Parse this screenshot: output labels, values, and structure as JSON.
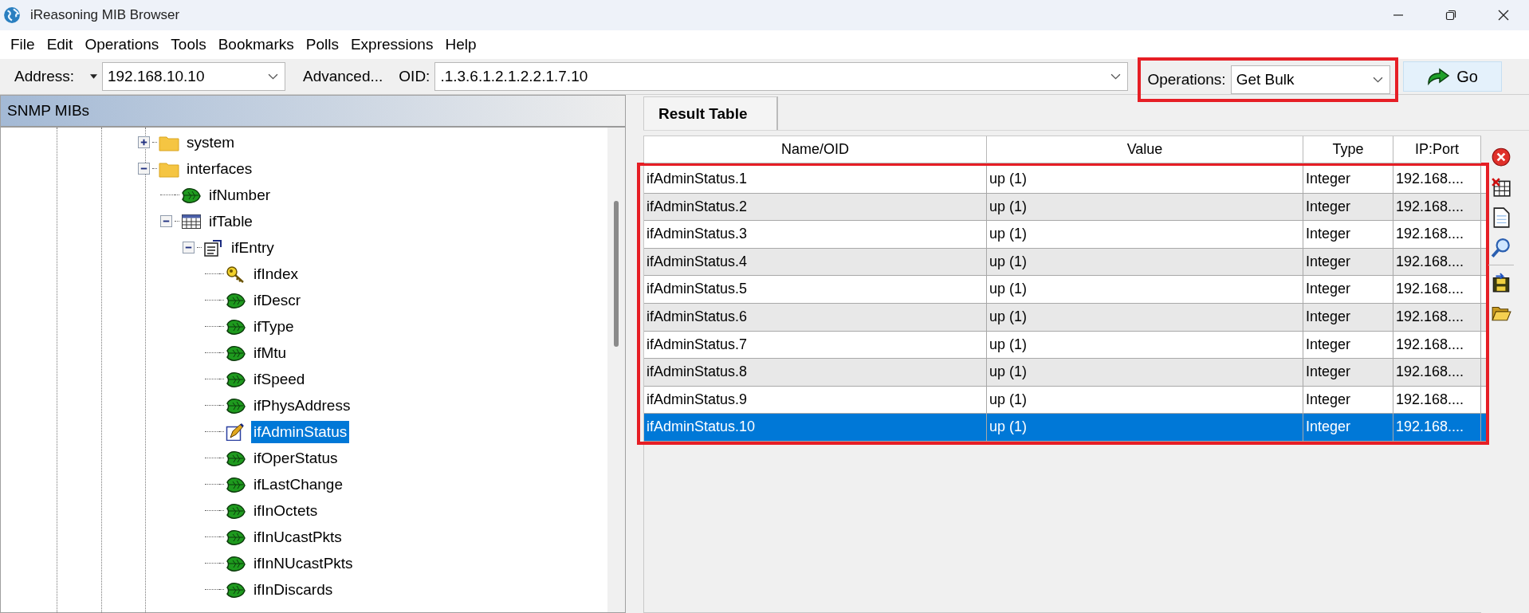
{
  "window": {
    "title": "iReasoning MIB Browser"
  },
  "menu": [
    "File",
    "Edit",
    "Operations",
    "Tools",
    "Bookmarks",
    "Polls",
    "Expressions",
    "Help"
  ],
  "toolbar": {
    "address_label": "Address:",
    "address": "192.168.10.10",
    "advanced_button": "Advanced...",
    "oid_label": "OID:",
    "oid": ".1.3.6.1.2.1.2.2.1.7.10",
    "operations": {
      "label": "Operations:",
      "value": "Get Bulk",
      "highlighted": true
    },
    "go_button": "Go"
  },
  "mib_panel": {
    "title": "SNMP MIBs",
    "tree": [
      {
        "label": "system",
        "kind": "folder",
        "expanded": false,
        "selected": false
      },
      {
        "label": "interfaces",
        "kind": "folder",
        "expanded": true,
        "selected": false,
        "children": [
          {
            "label": "ifNumber",
            "kind": "leaf",
            "selected": false
          },
          {
            "label": "ifTable",
            "kind": "table",
            "expanded": true,
            "selected": false,
            "children": [
              {
                "label": "ifEntry",
                "kind": "entry",
                "expanded": true,
                "selected": false,
                "children": [
                  {
                    "label": "ifIndex",
                    "kind": "key",
                    "selected": false
                  },
                  {
                    "label": "ifDescr",
                    "kind": "leaf",
                    "selected": false
                  },
                  {
                    "label": "ifType",
                    "kind": "leaf",
                    "selected": false
                  },
                  {
                    "label": "ifMtu",
                    "kind": "leaf",
                    "selected": false
                  },
                  {
                    "label": "ifSpeed",
                    "kind": "leaf",
                    "selected": false
                  },
                  {
                    "label": "ifPhysAddress",
                    "kind": "leaf",
                    "selected": false
                  },
                  {
                    "label": "ifAdminStatus",
                    "kind": "writable",
                    "selected": true
                  },
                  {
                    "label": "ifOperStatus",
                    "kind": "leaf",
                    "selected": false
                  },
                  {
                    "label": "ifLastChange",
                    "kind": "leaf",
                    "selected": false
                  },
                  {
                    "label": "ifInOctets",
                    "kind": "leaf",
                    "selected": false
                  },
                  {
                    "label": "ifInUcastPkts",
                    "kind": "leaf",
                    "selected": false
                  },
                  {
                    "label": "ifInNUcastPkts",
                    "kind": "leaf",
                    "selected": false
                  },
                  {
                    "label": "ifInDiscards",
                    "kind": "leaf",
                    "selected": false
                  }
                ]
              }
            ]
          }
        ]
      }
    ]
  },
  "result_panel": {
    "tabs": [
      {
        "label": "Result Table",
        "selected": true
      }
    ],
    "table": {
      "highlighted": true,
      "columns": [
        "Name/OID",
        "Value",
        "Type",
        "IP:Port"
      ],
      "rows": [
        {
          "cells": [
            "ifAdminStatus.1",
            "up (1)",
            "Integer",
            "192.168...."
          ],
          "selected": false
        },
        {
          "cells": [
            "ifAdminStatus.2",
            "up (1)",
            "Integer",
            "192.168...."
          ],
          "selected": false
        },
        {
          "cells": [
            "ifAdminStatus.3",
            "up (1)",
            "Integer",
            "192.168...."
          ],
          "selected": false
        },
        {
          "cells": [
            "ifAdminStatus.4",
            "up (1)",
            "Integer",
            "192.168...."
          ],
          "selected": false
        },
        {
          "cells": [
            "ifAdminStatus.5",
            "up (1)",
            "Integer",
            "192.168...."
          ],
          "selected": false
        },
        {
          "cells": [
            "ifAdminStatus.6",
            "up (1)",
            "Integer",
            "192.168...."
          ],
          "selected": false
        },
        {
          "cells": [
            "ifAdminStatus.7",
            "up (1)",
            "Integer",
            "192.168...."
          ],
          "selected": false
        },
        {
          "cells": [
            "ifAdminStatus.8",
            "up (1)",
            "Integer",
            "192.168...."
          ],
          "selected": false
        },
        {
          "cells": [
            "ifAdminStatus.9",
            "up (1)",
            "Integer",
            "192.168...."
          ],
          "selected": false
        },
        {
          "cells": [
            "ifAdminStatus.10",
            "up (1)",
            "Integer",
            "192.168...."
          ],
          "selected": true
        }
      ]
    }
  }
}
